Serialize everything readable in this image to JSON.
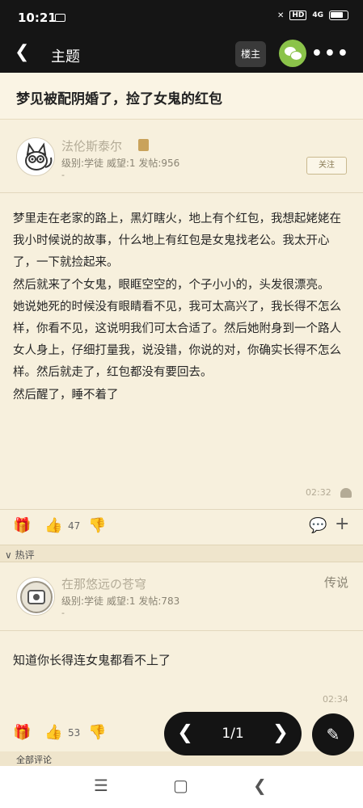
{
  "status_bar": {
    "time": "10:21",
    "hd_label": "HD",
    "signal_label": "4G"
  },
  "header": {
    "title": "主题",
    "owner_button": "楼主"
  },
  "thread": {
    "title": "梦见被配阴婚了，捡了女鬼的红包"
  },
  "post": {
    "author": {
      "name": "法伦斯泰尔",
      "meta": "级别:学徒 威望:1 发帖:956",
      "sub": "-",
      "follow_label": "关注"
    },
    "paragraphs": [
      "梦里走在老家的路上，黑灯瞎火，地上有个红包，我想起姥姥在我小时候说的故事，什么地上有红包是女鬼找老公。我太开心了，一下就捡起来。",
      "然后就来了个女鬼，眼眶空空的，个子小小的，头发很漂亮。",
      "她说她死的时候没有眼睛看不见，我可太高兴了，我长得不怎么样，你看不见，这说明我们可太合适了。然后她附身到一个路人女人身上，仔细打量我，说没错，你说的对，你确实长得不怎么样。然后就走了，红包都没有要回去。",
      "然后醒了，睡不着了"
    ],
    "time": "02:32",
    "likes": "47"
  },
  "hot_section": {
    "label": "热评"
  },
  "reply": {
    "author": {
      "name": "在那悠远の苍穹",
      "meta": "级别:学徒 威望:1 发帖:783",
      "sub": "-",
      "tag": "传说"
    },
    "body": "知道你长得连女鬼都看不上了",
    "time": "02:34",
    "likes": "53"
  },
  "all_comments": {
    "label": "全部评论"
  },
  "pager": {
    "page": "1/1"
  }
}
